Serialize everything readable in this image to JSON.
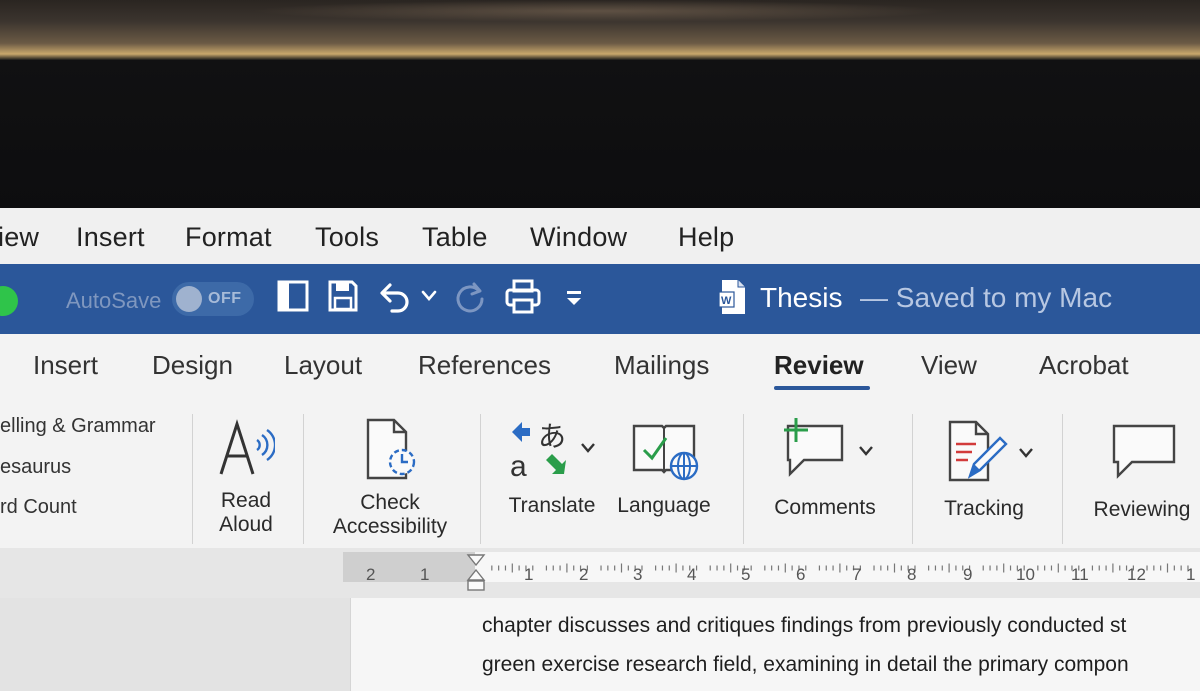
{
  "menu": {
    "items": [
      "iew",
      "Insert",
      "Format",
      "Tools",
      "Table",
      "Window",
      "Help"
    ]
  },
  "titlebar": {
    "autosave_label": "AutoSave",
    "autosave_state": "OFF",
    "doc_title": "Thesis",
    "doc_status": "— Saved to my Mac",
    "icons": [
      "sidebar-icon",
      "save-icon",
      "undo-icon",
      "chevron-down-icon",
      "redo-icon",
      "print-icon",
      "customize-toolbar-icon",
      "word-doc-icon"
    ]
  },
  "tabs": {
    "items": [
      "Insert",
      "Design",
      "Layout",
      "References",
      "Mailings",
      "Review",
      "View",
      "Acrobat"
    ],
    "active": "Review"
  },
  "ribbon": {
    "proofing": [
      "elling & Grammar",
      "esaurus",
      "rd Count"
    ],
    "read_aloud": [
      "Read",
      "Aloud"
    ],
    "check_accessibility": [
      "Check",
      "Accessibility"
    ],
    "translate": "Translate",
    "language": "Language",
    "comments": "Comments",
    "tracking": "Tracking",
    "reviewing": "Reviewing"
  },
  "ruler": {
    "left_numbers": [
      "2",
      "1"
    ],
    "right_numbers": [
      "1",
      "2",
      "3",
      "4",
      "5",
      "6",
      "7",
      "8",
      "9",
      "10",
      "11",
      "12",
      "1"
    ]
  },
  "document": {
    "lines": [
      "chapter discusses and critiques findings from previously conducted st",
      "green exercise research field, examining in detail the primary compon"
    ]
  },
  "colors": {
    "title_bar": "#2b579a",
    "menu_bar": "#f0f0f0",
    "ribbon": "#f3f3f3",
    "accent_underline": "#2b579a",
    "traffic_green": "#2fc44a"
  }
}
